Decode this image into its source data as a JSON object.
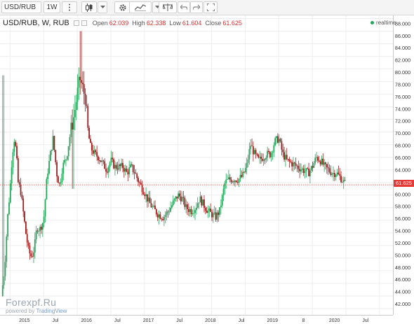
{
  "toolbar": {
    "symbol": "USD/RUB",
    "interval": "1W",
    "icons": [
      "more-vert-icon",
      "candles-icon",
      "chevron-down-icon",
      "gear-icon",
      "indicators-icon",
      "compare-scale-icon",
      "undo-icon",
      "redo-icon",
      "fullscreen-icon"
    ]
  },
  "legend": {
    "title": "USD/RUB, W, RUB",
    "open_label": "Open",
    "open": "62.039",
    "high_label": "High",
    "high": "62.338",
    "low_label": "Low",
    "low": "61.604",
    "close_label": "Close",
    "close": "61.625"
  },
  "realtime": "realtime",
  "last_price": "61.625",
  "watermark": {
    "brand": "Forexpf.Ru",
    "powered": "powered by",
    "provider": "TradingView"
  },
  "colors": {
    "up": "#26a65b",
    "down": "#a01f1f",
    "last_price": "#e53935",
    "grid": "#eeeeee"
  },
  "chart_data": {
    "type": "candlestick",
    "title": "USD/RUB, W, RUB",
    "ylim": [
      41.0,
      88.5
    ],
    "y_ticks": [
      42,
      44,
      46,
      48,
      50,
      52,
      54,
      56,
      58,
      60,
      62,
      64,
      66,
      68,
      70,
      72,
      74,
      76,
      78,
      80,
      82,
      84,
      86,
      88
    ],
    "x_ticks": [
      {
        "label": "2015",
        "t": 2015.0
      },
      {
        "label": "Jul",
        "t": 2015.5
      },
      {
        "label": "2016",
        "t": 2016.0
      },
      {
        "label": "Jul",
        "t": 2016.5
      },
      {
        "label": "2017",
        "t": 2017.0
      },
      {
        "label": "Jul",
        "t": 2017.5
      },
      {
        "label": "2018",
        "t": 2018.0
      },
      {
        "label": "Jul",
        "t": 2018.5
      },
      {
        "label": "2019",
        "t": 2019.0
      },
      {
        "label": "8",
        "t": 2019.5
      },
      {
        "label": "2020",
        "t": 2020.0
      },
      {
        "label": "Jul",
        "t": 2020.5
      }
    ],
    "xlim": [
      2014.85,
      2020.7
    ],
    "last_close": 61.625,
    "close_path": [
      [
        2014.87,
        44.0
      ],
      [
        2014.92,
        48.5
      ],
      [
        2014.96,
        56.0
      ],
      [
        2015.0,
        61.0
      ],
      [
        2015.03,
        66.0
      ],
      [
        2015.06,
        69.0
      ],
      [
        2015.09,
        67.0
      ],
      [
        2015.12,
        62.0
      ],
      [
        2015.16,
        60.5
      ],
      [
        2015.2,
        57.0
      ],
      [
        2015.24,
        53.5
      ],
      [
        2015.28,
        51.0
      ],
      [
        2015.32,
        50.2
      ],
      [
        2015.36,
        51.5
      ],
      [
        2015.4,
        55.0
      ],
      [
        2015.44,
        54.5
      ],
      [
        2015.5,
        56.0
      ],
      [
        2015.55,
        63.0
      ],
      [
        2015.6,
        66.5
      ],
      [
        2015.64,
        69.0
      ],
      [
        2015.7,
        63.0
      ],
      [
        2015.74,
        61.5
      ],
      [
        2015.78,
        64.5
      ],
      [
        2015.84,
        66.0
      ],
      [
        2015.9,
        70.0
      ],
      [
        2015.95,
        72.5
      ],
      [
        2016.0,
        76.0
      ],
      [
        2016.04,
        78.5
      ],
      [
        2016.08,
        77.0
      ],
      [
        2016.12,
        75.5
      ],
      [
        2016.16,
        70.0
      ],
      [
        2016.2,
        67.5
      ],
      [
        2016.26,
        66.5
      ],
      [
        2016.32,
        66.0
      ],
      [
        2016.38,
        65.0
      ],
      [
        2016.44,
        64.0
      ],
      [
        2016.5,
        65.5
      ],
      [
        2016.56,
        64.5
      ],
      [
        2016.62,
        64.5
      ],
      [
        2016.68,
        64.5
      ],
      [
        2016.74,
        63.5
      ],
      [
        2016.8,
        64.5
      ],
      [
        2016.86,
        63.5
      ],
      [
        2016.92,
        62.0
      ],
      [
        2017.0,
        60.5
      ],
      [
        2017.06,
        59.0
      ],
      [
        2017.12,
        58.0
      ],
      [
        2017.2,
        57.0
      ],
      [
        2017.28,
        56.5
      ],
      [
        2017.36,
        57.5
      ],
      [
        2017.44,
        59.0
      ],
      [
        2017.5,
        60.0
      ],
      [
        2017.56,
        59.5
      ],
      [
        2017.62,
        58.0
      ],
      [
        2017.7,
        57.5
      ],
      [
        2017.76,
        58.0
      ],
      [
        2017.82,
        59.5
      ],
      [
        2017.88,
        58.5
      ],
      [
        2017.94,
        57.5
      ],
      [
        2018.0,
        57.0
      ],
      [
        2018.06,
        56.5
      ],
      [
        2018.12,
        57.5
      ],
      [
        2018.2,
        62.0
      ],
      [
        2018.26,
        62.5
      ],
      [
        2018.32,
        62.5
      ],
      [
        2018.4,
        62.5
      ],
      [
        2018.46,
        63.0
      ],
      [
        2018.52,
        64.5
      ],
      [
        2018.58,
        68.0
      ],
      [
        2018.64,
        66.5
      ],
      [
        2018.7,
        65.5
      ],
      [
        2018.76,
        66.0
      ],
      [
        2018.82,
        66.5
      ],
      [
        2018.88,
        66.5
      ],
      [
        2018.94,
        68.5
      ],
      [
        2019.0,
        69.0
      ],
      [
        2019.06,
        66.5
      ],
      [
        2019.12,
        65.5
      ],
      [
        2019.2,
        65.0
      ],
      [
        2019.28,
        64.5
      ],
      [
        2019.36,
        64.0
      ],
      [
        2019.44,
        63.5
      ],
      [
        2019.5,
        64.5
      ],
      [
        2019.56,
        66.0
      ],
      [
        2019.62,
        65.5
      ],
      [
        2019.68,
        64.5
      ],
      [
        2019.74,
        64.0
      ],
      [
        2019.8,
        63.5
      ],
      [
        2019.86,
        63.5
      ],
      [
        2019.9,
        63.0
      ],
      [
        2019.94,
        62.5
      ],
      [
        2019.97,
        62.0
      ],
      [
        2020.0,
        61.625
      ]
    ]
  }
}
